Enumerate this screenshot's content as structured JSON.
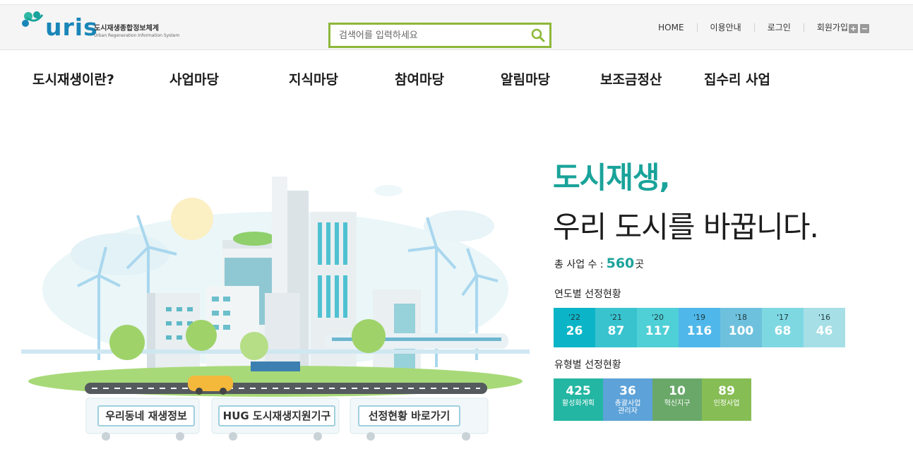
{
  "logo": {
    "wordmark": "uris",
    "title_kr": "도시재생종합정보체계",
    "title_en": "Urban Regeneration Information System"
  },
  "search": {
    "placeholder": "검색어를 입력하세요",
    "value": ""
  },
  "util_links": [
    "HOME",
    "이용안내",
    "로그인",
    "회원가입"
  ],
  "zoom": {
    "plus": "+",
    "minus": "−"
  },
  "nav": [
    "도시재생이란?",
    "사업마당",
    "지식마당",
    "참여마당",
    "알림마당",
    "보조금정산",
    "집수리 사업"
  ],
  "quick_buttons": [
    "우리동네 재생정보",
    "HUG 도시재생지원기구",
    "선정현황 바로가기"
  ],
  "hero": {
    "title": "도시재생,",
    "subtitle": "우리 도시를 바꿉니다."
  },
  "total": {
    "label": "총 사업 수 :",
    "value": "560",
    "unit": "곳"
  },
  "year_section_label": "연도별 선정현황",
  "years": [
    {
      "year": "'22",
      "value": "26",
      "color": "#0bb5c7"
    },
    {
      "year": "'21",
      "value": "87",
      "color": "#38c3cf"
    },
    {
      "year": "'20",
      "value": "117",
      "color": "#4fcfd6"
    },
    {
      "year": "'19",
      "value": "116",
      "color": "#4fb7ea"
    },
    {
      "year": "'18",
      "value": "100",
      "color": "#6ec1dd"
    },
    {
      "year": "'17",
      "value": "68",
      "color": "#7ed8e2"
    },
    {
      "year": "'16",
      "value": "46",
      "color": "#a6dfe6"
    }
  ],
  "type_section_label": "유형별 선정현황",
  "types": [
    {
      "value": "425",
      "label": "활성화계획",
      "color": "#23b6a2"
    },
    {
      "value": "36",
      "label": "총괄사업\n관리자",
      "color": "#5da2d8"
    },
    {
      "value": "10",
      "label": "혁신지구",
      "color": "#6aa86a"
    },
    {
      "value": "89",
      "label": "인정사업",
      "color": "#86bd55"
    }
  ]
}
